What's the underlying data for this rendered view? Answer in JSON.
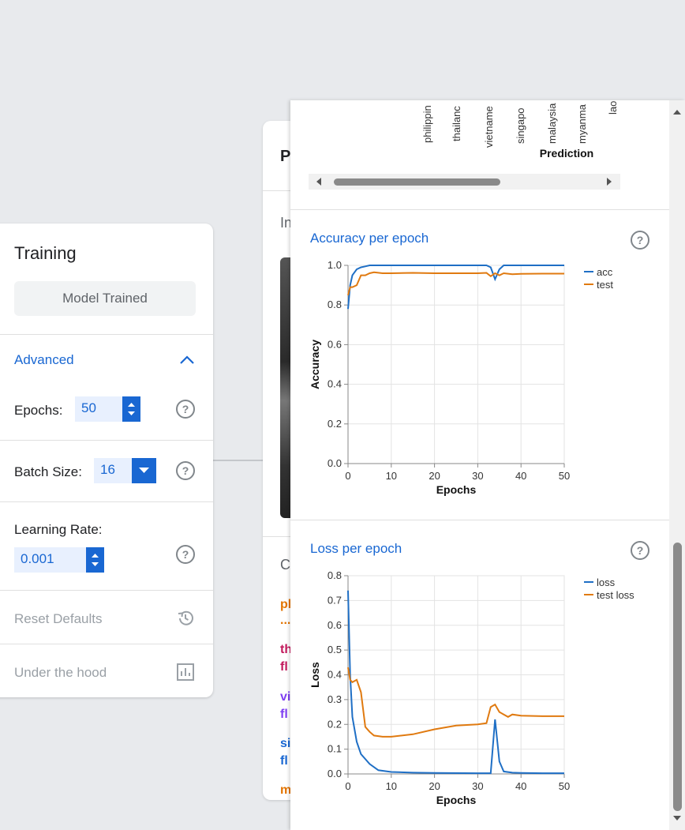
{
  "training": {
    "title": "Training",
    "status_button": "Model Trained",
    "advanced_label": "Advanced",
    "epochs_label": "Epochs:",
    "epochs_value": "50",
    "batch_label": "Batch Size:",
    "batch_value": "16",
    "lr_label": "Learning Rate:",
    "lr_value": "0.001",
    "reset_label": "Reset Defaults",
    "hood_label": "Under the hood"
  },
  "preview": {
    "heading_initial": "P",
    "input_initial": "In",
    "classes_initial": "C",
    "class_snippets": [
      "ph",
      "...",
      "th",
      "fl",
      "vi",
      "fl",
      "si",
      "fl",
      "m"
    ]
  },
  "hood_panel": {
    "confusion": {
      "prediction_axis_label": "Prediction",
      "column_labels": [
        "philippin",
        "thailanc",
        "vietname",
        "singapo",
        "malaysia",
        "myanma",
        "lao"
      ]
    },
    "accuracy_section_title": "Accuracy per epoch",
    "loss_section_title": "Loss per epoch"
  },
  "colors": {
    "accent": "#1967d2",
    "series_train": "#1f6fc5",
    "series_test": "#e07a10"
  },
  "chart_data": [
    {
      "type": "line",
      "title": "Accuracy per epoch",
      "xlabel": "Epochs",
      "ylabel": "Accuracy",
      "xlim": [
        0,
        50
      ],
      "ylim": [
        0,
        1.0
      ],
      "xticks": [
        0,
        10,
        20,
        30,
        40,
        50
      ],
      "yticks": [
        0.0,
        0.2,
        0.4,
        0.6,
        0.8,
        1.0
      ],
      "grid": true,
      "legend_position": "right",
      "series": [
        {
          "name": "acc",
          "color": "#1f6fc5",
          "x": [
            0,
            0.5,
            1,
            2,
            3,
            4,
            5,
            6,
            10,
            20,
            30,
            32,
            33,
            34,
            35,
            36,
            40,
            45,
            50
          ],
          "y": [
            0.78,
            0.9,
            0.95,
            0.98,
            0.99,
            0.995,
            1.0,
            1.0,
            1.0,
            1.0,
            1.0,
            1.0,
            0.99,
            0.93,
            0.98,
            1.0,
            1.0,
            1.0,
            1.0
          ]
        },
        {
          "name": "test",
          "color": "#e07a10",
          "x": [
            0,
            0.5,
            1,
            2,
            3,
            4,
            5,
            6,
            8,
            10,
            15,
            20,
            25,
            30,
            32,
            33,
            34,
            35,
            36,
            38,
            40,
            45,
            50
          ],
          "y": [
            0.85,
            0.89,
            0.89,
            0.9,
            0.95,
            0.95,
            0.96,
            0.965,
            0.96,
            0.96,
            0.962,
            0.96,
            0.96,
            0.96,
            0.962,
            0.945,
            0.96,
            0.95,
            0.96,
            0.955,
            0.957,
            0.958,
            0.958
          ]
        }
      ]
    },
    {
      "type": "line",
      "title": "Loss per epoch",
      "xlabel": "Epochs",
      "ylabel": "Loss",
      "xlim": [
        0,
        50
      ],
      "ylim": [
        0,
        0.8
      ],
      "xticks": [
        0,
        10,
        20,
        30,
        40,
        50
      ],
      "yticks": [
        0.0,
        0.1,
        0.2,
        0.3,
        0.4,
        0.5,
        0.6,
        0.7,
        0.8
      ],
      "grid": true,
      "legend_position": "right",
      "series": [
        {
          "name": "loss",
          "color": "#1f6fc5",
          "x": [
            0,
            0.5,
            1,
            2,
            3,
            5,
            7,
            10,
            15,
            20,
            30,
            33,
            34,
            35,
            36,
            38,
            40,
            45,
            50
          ],
          "y": [
            0.74,
            0.4,
            0.23,
            0.13,
            0.08,
            0.04,
            0.015,
            0.008,
            0.005,
            0.004,
            0.003,
            0.003,
            0.22,
            0.05,
            0.01,
            0.005,
            0.004,
            0.003,
            0.003
          ]
        },
        {
          "name": "test loss",
          "color": "#e07a10",
          "x": [
            0,
            0.5,
            1,
            2,
            3,
            4,
            5,
            6,
            8,
            10,
            15,
            20,
            25,
            30,
            32,
            33,
            34,
            35,
            36,
            37,
            38,
            40,
            45,
            50
          ],
          "y": [
            0.43,
            0.38,
            0.37,
            0.38,
            0.33,
            0.19,
            0.17,
            0.155,
            0.15,
            0.15,
            0.16,
            0.18,
            0.195,
            0.2,
            0.205,
            0.27,
            0.28,
            0.25,
            0.24,
            0.23,
            0.24,
            0.235,
            0.233,
            0.233
          ]
        }
      ]
    }
  ]
}
